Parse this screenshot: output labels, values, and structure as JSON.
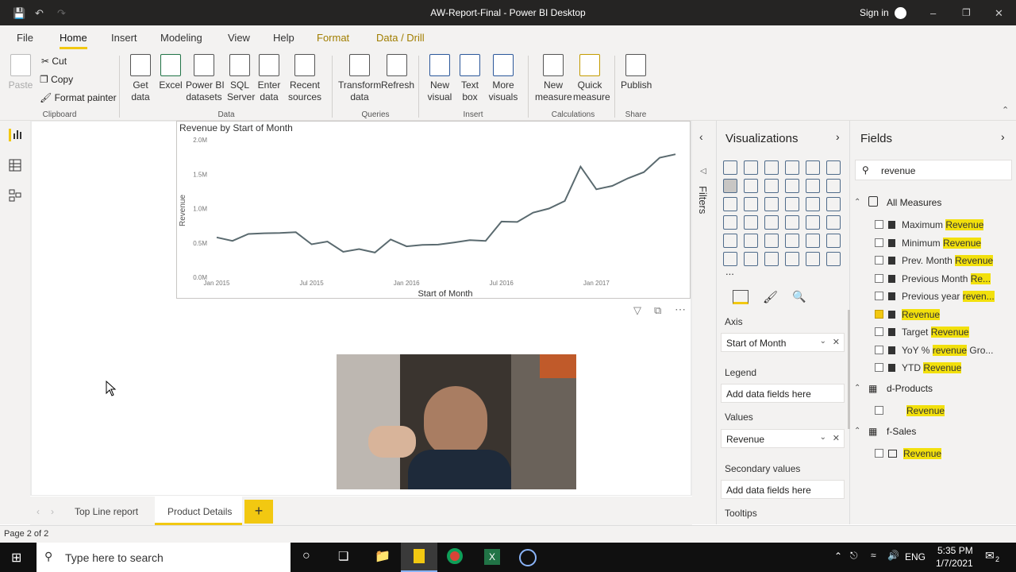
{
  "window": {
    "title": "AW-Report-Final - Power BI Desktop",
    "sign_in": "Sign in"
  },
  "menu": [
    "File",
    "Home",
    "Insert",
    "Modeling",
    "View",
    "Help",
    "Format",
    "Data / Drill"
  ],
  "ribbon": {
    "paste": "Paste",
    "cut": "Cut",
    "copy": "Copy",
    "format_painter": "Format painter",
    "clipboard": "Clipboard",
    "get_data": "Get\ndata",
    "excel": "Excel",
    "pbi_datasets": "Power BI\ndatasets",
    "sql_server": "SQL\nServer",
    "enter_data": "Enter\ndata",
    "recent_sources": "Recent\nsources",
    "data": "Data",
    "transform_data": "Transform\ndata",
    "refresh": "Refresh",
    "queries": "Queries",
    "new_visual": "New\nvisual",
    "text_box": "Text\nbox",
    "more_visuals": "More\nvisuals",
    "insert": "Insert",
    "new_measure": "New\nmeasure",
    "quick_measure": "Quick\nmeasure",
    "calculations": "Calculations",
    "publish": "Publish",
    "share": "Share"
  },
  "chart_data": {
    "type": "line",
    "title": "Revenue by Start of Month",
    "xlabel": "Start of Month",
    "ylabel": "Revenue",
    "yticks": [
      "0.0M",
      "0.5M",
      "1.0M",
      "1.5M",
      "2.0M"
    ],
    "xticks": [
      "Jan 2015",
      "Jul 2015",
      "Jan 2016",
      "Jul 2016",
      "Jan 2017"
    ],
    "ylim": [
      0,
      2000000
    ],
    "series": [
      {
        "values": [
          580000,
          530000,
          630000,
          640000,
          645000,
          655000,
          480000,
          520000,
          370000,
          410000,
          360000,
          550000,
          450000,
          470000,
          475000,
          505000,
          540000,
          530000,
          810000,
          805000,
          940000,
          1000000,
          1110000,
          1610000,
          1280000,
          1330000,
          1440000,
          1530000,
          1740000,
          1790000
        ]
      }
    ]
  },
  "canvas": {
    "page_indicator": "Page 2 of 2",
    "tabs": [
      "Top Line report",
      "Product Details"
    ],
    "add_tab": "+"
  },
  "filters": {
    "label": "Filters"
  },
  "visualizations": {
    "title": "Visualizations",
    "axis_label": "Axis",
    "axis_value": "Start of Month",
    "legend_label": "Legend",
    "legend_placeholder": "Add data fields here",
    "values_label": "Values",
    "values_value": "Revenue",
    "secondary_label": "Secondary values",
    "secondary_placeholder": "Add data fields here",
    "tooltips_label": "Tooltips",
    "more": "..."
  },
  "fields": {
    "title": "Fields",
    "search": "revenue",
    "groups": [
      {
        "name": "All Measures"
      },
      {
        "name": "d-Products"
      },
      {
        "name": "f-Sales"
      }
    ],
    "measures": [
      {
        "pre": "Maximum ",
        "hl": "Revenue",
        "post": ""
      },
      {
        "pre": "Minimum ",
        "hl": "Revenue",
        "post": ""
      },
      {
        "pre": "Prev. Month ",
        "hl": "Revenue",
        "post": ""
      },
      {
        "pre": "Previous Month ",
        "hl": "Re...",
        "post": ""
      },
      {
        "pre": "Previous year ",
        "hl": "reven...",
        "post": ""
      },
      {
        "pre": "",
        "hl": "Revenue",
        "post": ""
      },
      {
        "pre": "Target ",
        "hl": "Revenue",
        "post": ""
      },
      {
        "pre": "YoY % ",
        "hl": "revenue",
        "post": " Gro..."
      },
      {
        "pre": "YTD ",
        "hl": "Revenue",
        "post": ""
      }
    ],
    "d_products_item": "Revenue",
    "f_sales_item": "Revenue"
  },
  "taskbar": {
    "search": "Type here to search",
    "time": "5:35 PM",
    "date": "1/7/2021",
    "lang": "ENG",
    "notif": "2"
  }
}
